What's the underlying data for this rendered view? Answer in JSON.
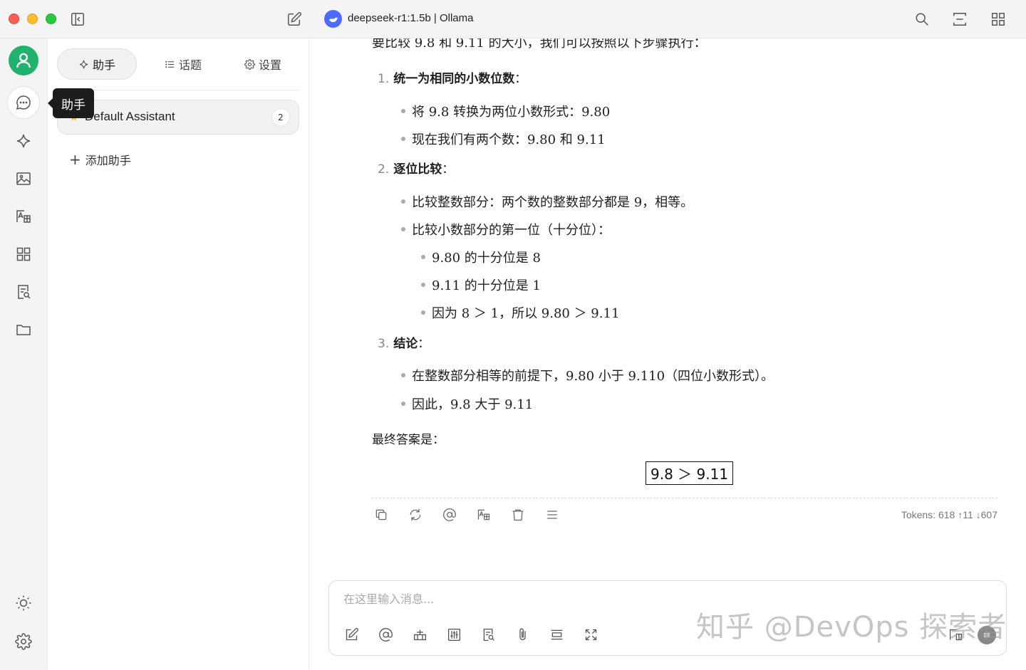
{
  "window": {
    "model_title": "deepseek-r1:1.5b | Ollama"
  },
  "rail": {
    "tooltip": "助手",
    "icons": [
      "user-avatar-icon",
      "chat-icon",
      "sparkle-icon",
      "image-icon",
      "translate-icon",
      "apps-grid-icon",
      "document-search-icon",
      "folder-icon",
      "theme-sun-icon",
      "settings-gear-icon"
    ]
  },
  "panel": {
    "tabs": [
      {
        "label": "助手",
        "icon": "sparkle-icon"
      },
      {
        "label": "话题",
        "icon": "list-icon"
      },
      {
        "label": "设置",
        "icon": "gear-icon"
      }
    ],
    "assistant": {
      "emoji": "★",
      "name": "Default Assistant",
      "count": "2"
    },
    "add_label": "添加助手"
  },
  "message": {
    "intro": "要比较 9.8 和 9.11 的大小，我们可以按照以下步骤执行：",
    "steps": [
      {
        "num": "1.",
        "title": "统一为相同的小数位数",
        "suffix": "：",
        "bullets": [
          "将 9.8 转换为两位小数形式：9.80",
          "现在我们有两个数：9.80 和 9.11"
        ]
      },
      {
        "num": "2.",
        "title": "逐位比较",
        "suffix": "：",
        "bullets": [
          "比较整数部分：两个数的整数部分都是 9，相等。",
          "比较小数部分的第一位（十分位）："
        ],
        "sub_bullets": [
          "9.80 的十分位是 8",
          "9.11 的十分位是 1",
          "因为 8 ＞ 1，所以 9.80 ＞ 9.11"
        ]
      },
      {
        "num": "3.",
        "title": "结论",
        "suffix": "：",
        "bullets": [
          "在整数部分相等的前提下，9.80 小于 9.110（四位小数形式）。",
          "因此，9.8 大于 9.11"
        ]
      }
    ],
    "final_label": "最终答案是：",
    "final_answer": "9.8 ＞ 9.11",
    "tokens": "Tokens: 618 ↑11 ↓607"
  },
  "input": {
    "placeholder": "在这里输入消息..."
  },
  "watermark": "知乎 @DevOps 探索者",
  "colors": {
    "accent_green": "#21b26d",
    "model_blue": "#4d6bfe"
  }
}
